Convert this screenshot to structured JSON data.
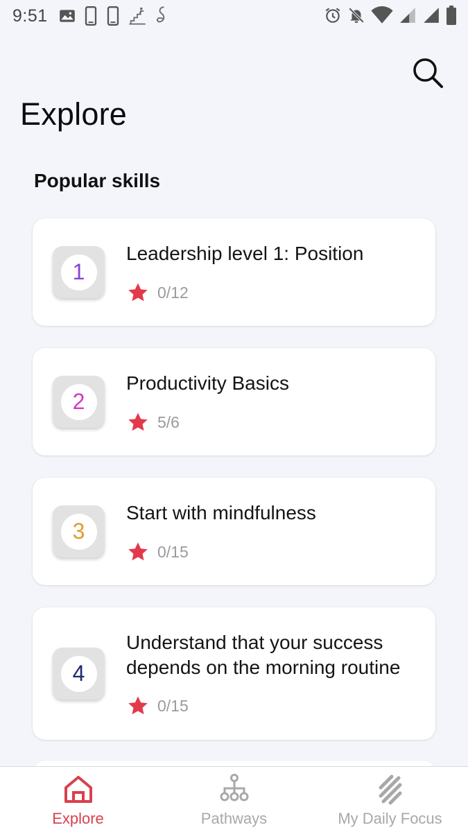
{
  "status_bar": {
    "time": "9:51",
    "left_icons": [
      "image-icon",
      "phone-icon",
      "phone-icon",
      "stairs-icon",
      "signature-icon"
    ],
    "right_icons": [
      "alarm-icon",
      "notifications-off-icon",
      "wifi-icon",
      "signal-icon",
      "signal-icon",
      "battery-icon"
    ]
  },
  "header": {
    "title": "Explore",
    "search_icon": "search-icon"
  },
  "section": {
    "title": "Popular skills"
  },
  "skills": [
    {
      "number": "1",
      "title": "Leadership level 1: Position",
      "progress": "0/12",
      "number_color": "#8b3fd6"
    },
    {
      "number": "2",
      "title": "Productivity Basics",
      "progress": "5/6",
      "number_color": "#d03cc0"
    },
    {
      "number": "3",
      "title": "Start with mindfulness",
      "progress": "0/15",
      "number_color": "#e39a35"
    },
    {
      "number": "4",
      "title": "Understand that your success depends on the morning routine",
      "progress": "0/15",
      "number_color": "#202a6e"
    }
  ],
  "colors": {
    "accent": "#d9404f",
    "star": "#e23a4b",
    "inactive": "#a8a8a8",
    "background": "#f3f5fa"
  },
  "bottom_nav": [
    {
      "label": "Explore",
      "icon": "home-icon",
      "active": true
    },
    {
      "label": "Pathways",
      "icon": "pathways-icon",
      "active": false
    },
    {
      "label": "My Daily Focus",
      "icon": "daily-focus-icon",
      "active": false
    }
  ]
}
